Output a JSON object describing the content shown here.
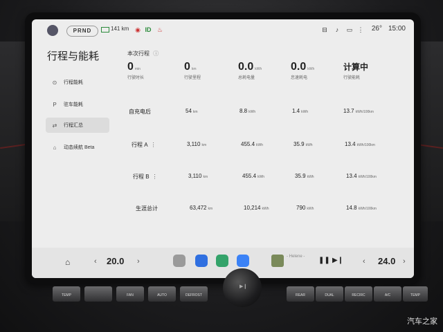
{
  "status_bar": {
    "gear": "PRND",
    "range": "141 km",
    "id_label": "ID",
    "temperature": "26°",
    "time": "15:00"
  },
  "sidebar": {
    "title": "行程与能耗",
    "items": [
      {
        "label": "行程能耗",
        "icon": "target-icon"
      },
      {
        "label": "驻车能耗",
        "icon": "parking-icon"
      },
      {
        "label": "行程汇总",
        "icon": "swap-icon",
        "active": true
      },
      {
        "label": "动态续航 Beta",
        "icon": "dynamic-range-icon"
      }
    ]
  },
  "trip": {
    "section_title": "本次行程",
    "metrics": [
      {
        "value": "0",
        "unit": "min",
        "label": "行驶时长"
      },
      {
        "value": "0",
        "unit": "km",
        "label": "行驶里程"
      },
      {
        "value": "0.0",
        "unit": "kWh",
        "label": "总耗电量"
      },
      {
        "value": "0.0",
        "unit": "kWh",
        "label": "怠速耗电"
      },
      {
        "value": "计算中",
        "unit": "",
        "label": "行驶能耗"
      }
    ]
  },
  "summary_rows": [
    {
      "name": "自充电后",
      "menu": false,
      "distance": "54",
      "distance_unit": "km",
      "energy": "8.8",
      "energy_unit": "kWh",
      "idle": "1.4",
      "idle_unit": "kWh",
      "consumption": "13.7",
      "consumption_unit": "kWh/100km"
    },
    {
      "name": "行程 A",
      "menu": true,
      "distance": "3,110",
      "distance_unit": "km",
      "energy": "455.4",
      "energy_unit": "kWh",
      "idle": "35.9",
      "idle_unit": "kWh",
      "consumption": "13.4",
      "consumption_unit": "kWh/100km"
    },
    {
      "name": "行程 B",
      "menu": true,
      "distance": "3,110",
      "distance_unit": "km",
      "energy": "455.4",
      "energy_unit": "kWh",
      "idle": "35.9",
      "idle_unit": "kWh",
      "consumption": "13.4",
      "consumption_unit": "kWh/100km"
    },
    {
      "name": "生涯总计",
      "menu": false,
      "distance": "63,472",
      "distance_unit": "km",
      "energy": "10,214",
      "energy_unit": "kWh",
      "idle": "790",
      "idle_unit": "kWh",
      "consumption": "14.8",
      "consumption_unit": "kWh/100km"
    }
  ],
  "dock": {
    "left_temp": "20.0",
    "right_temp": "24.0",
    "media_title": "- Helene -",
    "apps": [
      "steering-wheel-icon",
      "video-call-icon",
      "maps-icon",
      "app-grid-icon"
    ],
    "app_colors": [
      "#9a9a9a",
      "#2f6fe0",
      "#34a36a",
      "#3b82f6"
    ]
  },
  "physical_buttons": {
    "left": [
      "TEMP",
      "",
      "FAN",
      "AUTO",
      "DEFROST"
    ],
    "right": [
      "REAR",
      "DUAL",
      "RECIRC",
      "A/C",
      "TEMP"
    ]
  },
  "watermark": "汽车之家"
}
